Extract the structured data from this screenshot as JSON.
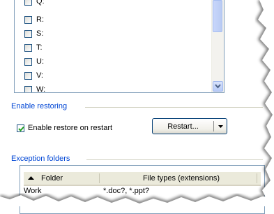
{
  "drives": [
    {
      "label": "Q:"
    },
    {
      "label": "R:"
    },
    {
      "label": "S:"
    },
    {
      "label": "T:"
    },
    {
      "label": "U:"
    },
    {
      "label": "V:"
    },
    {
      "label": "W:"
    }
  ],
  "restoring": {
    "title": "Enable restoring",
    "checkbox_label": "Enable restore on restart",
    "checked": true,
    "restart_button": "Restart..."
  },
  "exceptions": {
    "title": "Exception folders",
    "columns": [
      "Folder",
      "File types (extensions)"
    ],
    "rows": [
      {
        "folder": "Work",
        "types": "*.doc?, *.ppt?"
      }
    ]
  },
  "colors": {
    "group_title": "#0046d5",
    "border": "#7f9db9",
    "checkmark": "#21a121"
  },
  "icons": [
    "checkbox",
    "checkmark-icon",
    "scroll-down-arrow-icon",
    "dropdown-arrow-icon",
    "sort-up-icon"
  ]
}
